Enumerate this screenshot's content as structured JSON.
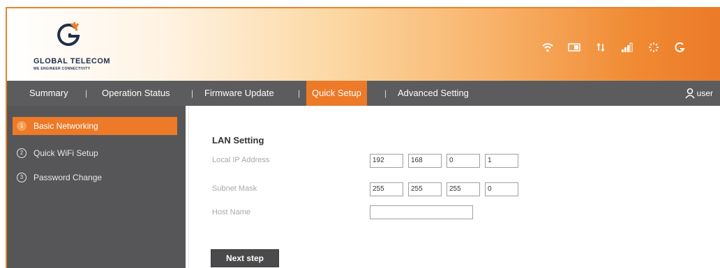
{
  "brand": {
    "name": "GLOBAL TELECOM",
    "tagline": "WE ENGINEER CONNECTIVITY",
    "accent": "#ec7a28"
  },
  "status_icons": [
    "wifi-icon",
    "sim-card-icon",
    "data-transfer-icon",
    "signal-bars-icon",
    "sun-icon",
    "power-icon"
  ],
  "nav": {
    "items": [
      {
        "label": "Summary"
      },
      {
        "label": "Operation Status"
      },
      {
        "label": "Firmware Update"
      },
      {
        "label": "Quick Setup",
        "active": true
      },
      {
        "label": "Advanced Setting"
      }
    ],
    "separator": "|",
    "user_label": "user"
  },
  "sidebar": {
    "items": [
      {
        "num": "①",
        "label": "Basic Networking",
        "active": true
      },
      {
        "num": "②",
        "label": "Quick WiFi Setup"
      },
      {
        "num": "③",
        "label": "Password Change"
      }
    ]
  },
  "lan": {
    "title": "LAN Setting",
    "local_ip_label": "Local IP Address",
    "local_ip": [
      "192",
      "168",
      "0",
      "1"
    ],
    "subnet_label": "Subnet Mask",
    "subnet": [
      "255",
      "255",
      "255",
      "0"
    ],
    "host_label": "Host Name",
    "host_value": ""
  },
  "next_step_label": "Next step"
}
